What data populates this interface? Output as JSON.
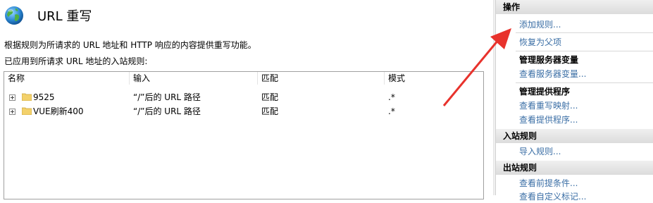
{
  "header": {
    "title": "URL 重写"
  },
  "description": {
    "line1": "根据规则为所请求的 URL 地址和 HTTP 响应的内容提供重写功能。",
    "line2": "已应用到所请求 URL 地址的入站规则:"
  },
  "table": {
    "columns": [
      "名称",
      "输入",
      "匹配",
      "模式"
    ],
    "rows": [
      {
        "name": "9525",
        "input": "“/”后的 URL 路径",
        "match": "匹配",
        "pattern": ".*"
      },
      {
        "name": "VUE刷新400",
        "input": "“/”后的 URL 路径",
        "match": "匹配",
        "pattern": ".*"
      }
    ]
  },
  "actions": {
    "title": "操作",
    "add_rule": "添加规则...",
    "revert_parent": "恢复为父项",
    "server_vars_title": "管理服务器变量",
    "view_server_vars": "查看服务器变量...",
    "providers_title": "管理提供程序",
    "view_rewrite_maps": "查看重写映射...",
    "view_providers": "查看提供程序...",
    "inbound_title": "入站规则",
    "import_rules": "导入规则...",
    "outbound_title": "出站规则",
    "view_preconditions": "查看前提条件...",
    "partial_item": "查看自定义标记..."
  },
  "colors": {
    "link": "#3a6ea5",
    "annotation_arrow": "#e8322c"
  }
}
